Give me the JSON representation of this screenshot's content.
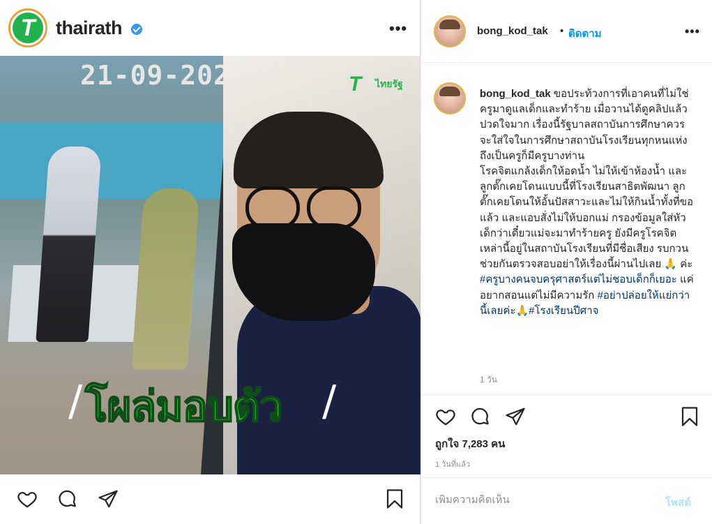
{
  "left": {
    "username": "thairath",
    "logo_glyph": "T",
    "more_glyph": "•••",
    "image": {
      "date_overlay": "21-09-202",
      "brand_glyph": "T",
      "brand_text": "ไทยรัฐ",
      "headline": "โผล่มอบตัว",
      "slash_left": "/",
      "slash_right": "/"
    },
    "actions": [
      "heart-icon",
      "comment-icon",
      "share-icon",
      "bookmark-icon"
    ]
  },
  "right": {
    "username": "bong_kod_tak",
    "separator": "•",
    "follow_label": "ติดตาม",
    "more_glyph": "•••",
    "caption": {
      "username": "bong_kod_tak",
      "text_1": " ขอประท้วงการที่เอาคนที่ไม่ใช่ครูมาดูแลเด็กและทำร้าย เมื่อวานได้ดูคลิปแล้วปวดใจมาก เรื่องนี้รัฐบาลสถาบันการศึกษาควรจะใส่ใจในการศึกษาสถาบันโรงเรียนทุกหนแห่ง ถึงเป็นครูก็มีครูบางท่าน",
      "text_2": "โรคจิตแกล้งเด็กให้อดน้ำ ไม่ให้เข้าห้องน้ำ และลูกตั๊กเคยโดนแบบนี้ที่โรงเรียนสาธิตพัฒนา ลูกตั๊กเคยโดนให้อั้นปัสสาวะและไม่ให้กินน้ำทั้งที่ขอแล้ว และแอบสั่งไม่ให้บอกแม่ กรองข้อมูลใส่หัวเด็กว่าเดี๋ยวแม่จะมาทำร้ายครู ยังมีครูโรคจิตเหล่านี้อยู่ในสถาบันโรงเรียนที่มีชื่อเสียง รบกวนช่วยกันตรวจสอบอย่าให้เรื่องนี้ผ่านไปเลย 🙏 ค่ะ ",
      "hashtag_1": "#ครูบางคนจบครุศาสตร์แต่ไม่ชอบเด็กก็เยอะ",
      "text_3": " แค่อยากสอนแต่ไม่มีความรัก ",
      "hashtag_2": "#อย่าปล่อยให้แย่กว่านี้เลยค่ะ",
      "emoji": "🙏",
      "hashtag_3": "#โรงเรียนปีศาจ",
      "time": "1 วัน"
    },
    "likes": "ถูกใจ 7,283 คน",
    "posted": "1 วันที่แล้ว",
    "comment_placeholder": "เพิ่มความคิดเห็น",
    "post_label": "โพสต์",
    "actions": [
      "heart-icon",
      "comment-icon",
      "share-icon",
      "bookmark-icon"
    ]
  }
}
